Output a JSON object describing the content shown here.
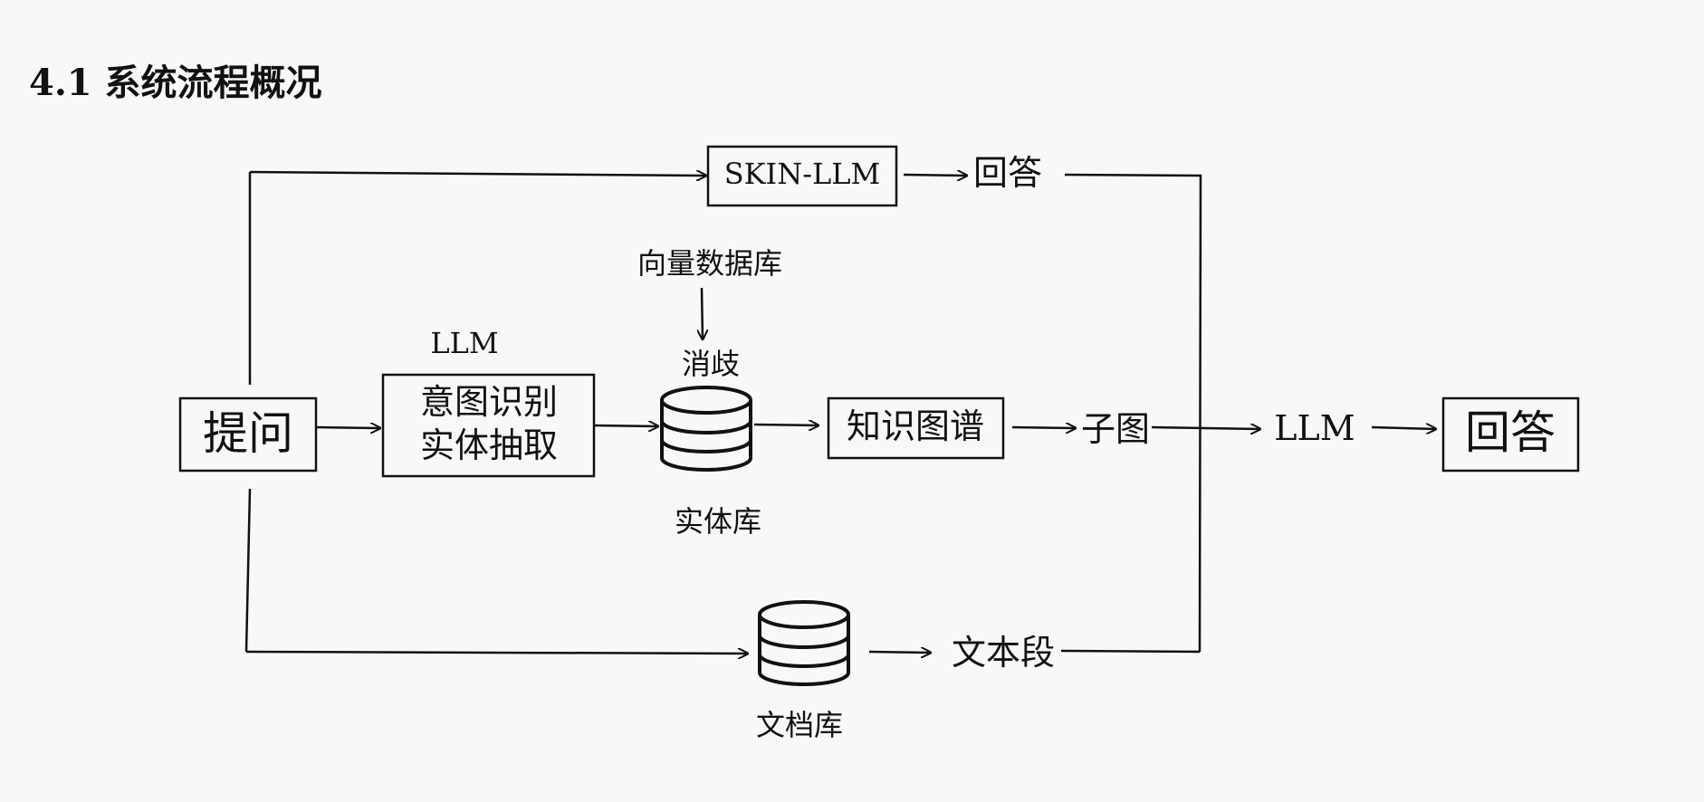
{
  "title": "4.1 系统流程概况",
  "nodes": {
    "question": "提问",
    "skin_llm": "SKIN-LLM",
    "answer_top": "回答",
    "vector_db": "向量数据库",
    "disambig": "消歧",
    "llm_small": "LLM",
    "intent_line1": "意图识别",
    "intent_line2": "实体抽取",
    "entity_db": "实体库",
    "kg": "知识图谱",
    "subgraph": "子图",
    "llm_mid": "LLM",
    "answer_final": "回答",
    "doc_db": "文档库",
    "text_seg": "文本段"
  }
}
